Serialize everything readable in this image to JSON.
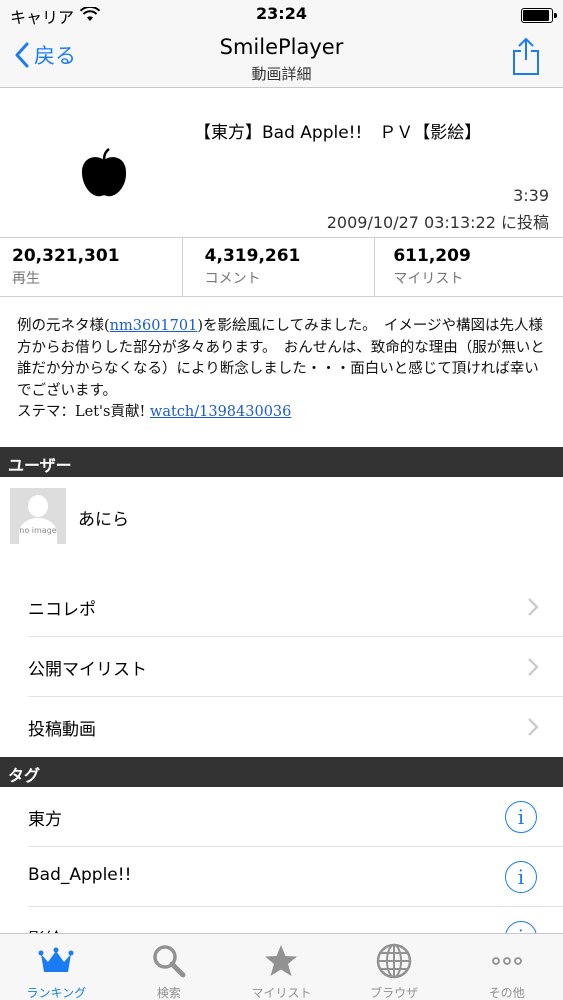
{
  "status_bar": {
    "carrier": "キャリア",
    "time": "23:24"
  },
  "nav": {
    "back_label": "戻る",
    "title": "SmilePlayer",
    "subtitle": "動画詳細"
  },
  "video": {
    "title": "【東方】Bad Apple!!　ＰＶ【影絵】",
    "duration": "3:39",
    "posted": "2009/10/27 03:13:22 に投稿"
  },
  "stats": [
    {
      "value": "20,321,301",
      "label": "再生"
    },
    {
      "value": "4,319,261",
      "label": "コメント"
    },
    {
      "value": "611,209",
      "label": "マイリスト"
    }
  ],
  "description": {
    "part1": "例の元ネタ様(",
    "link1": "nm3601701",
    "part2": ")を影絵風にしてみました。　イメージや構図は先人様方からお借りした部分が多々あります。　おんせんは、致命的な理由（服が無いと誰だか分からなくなる）により断念しました・・・面白いと感じて頂ければ幸いでございます。",
    "part3": "ステマ：Let's貢献! ",
    "link2": "watch/1398430036"
  },
  "user_section": {
    "header": "ユーザー",
    "avatar_text": "no image",
    "name": "あにら",
    "items": [
      {
        "label": "ニコレポ"
      },
      {
        "label": "公開マイリスト"
      },
      {
        "label": "投稿動画"
      }
    ]
  },
  "tag_section": {
    "header": "タグ",
    "tags": [
      {
        "label": "東方"
      },
      {
        "label": "Bad_Apple!!"
      },
      {
        "label": "影絵"
      }
    ]
  },
  "tab_bar": {
    "tabs": [
      {
        "label": "ランキング",
        "icon": "crown-icon"
      },
      {
        "label": "検索",
        "icon": "search-icon"
      },
      {
        "label": "マイリスト",
        "icon": "star-icon"
      },
      {
        "label": "ブラウザ",
        "icon": "globe-icon"
      },
      {
        "label": "その他",
        "icon": "more-icon"
      }
    ],
    "active_index": 0
  },
  "colors": {
    "accent": "#1a7cf5",
    "section_header": "#333333",
    "link": "#1a5bd6"
  }
}
